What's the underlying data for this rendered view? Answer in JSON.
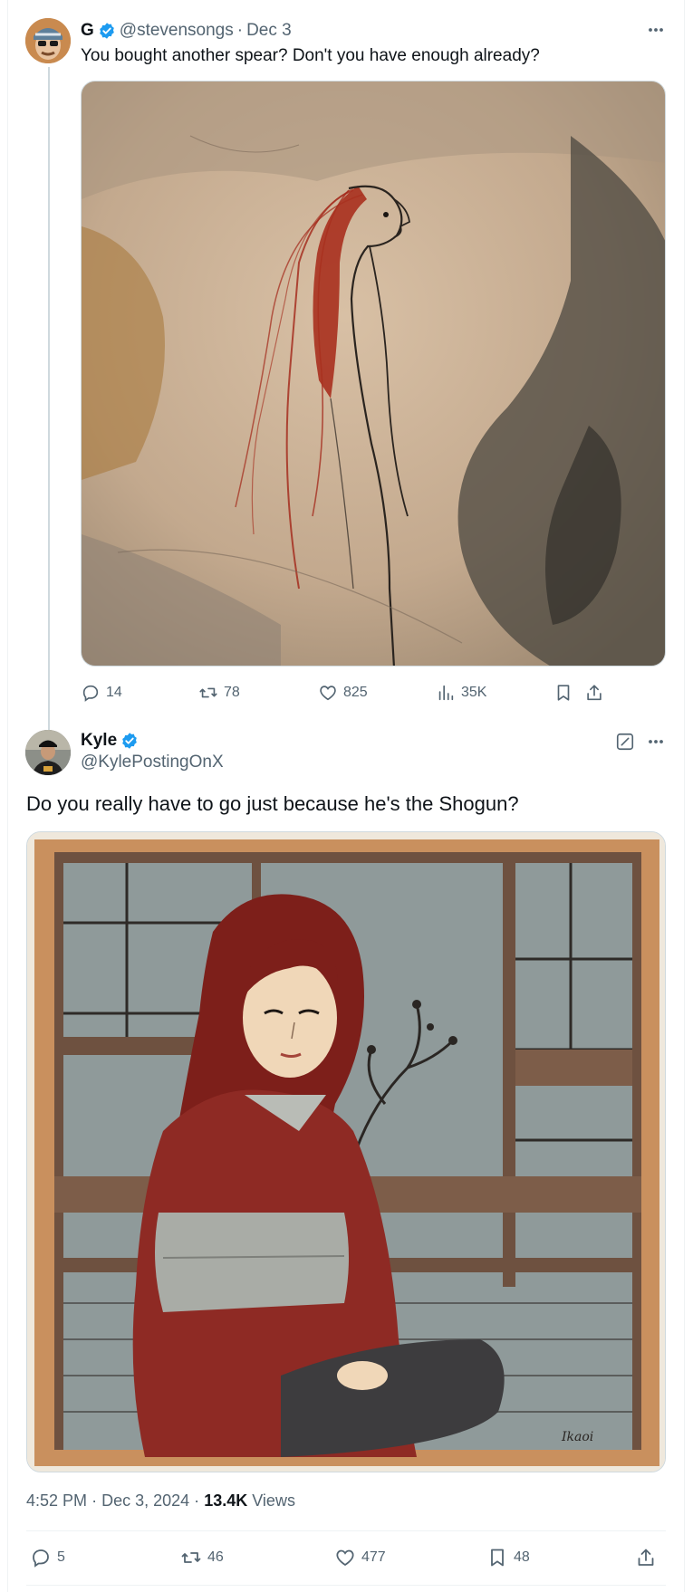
{
  "parent_tweet": {
    "display_name": "G",
    "handle": "@stevensongs",
    "separator": "·",
    "date": "Dec 3",
    "text": "You bought another spear? Don't you have enough already?",
    "replies": "14",
    "reposts": "78",
    "likes": "825",
    "views": "35K"
  },
  "main_tweet": {
    "display_name": "Kyle",
    "handle": "@KylePostingOnX",
    "text": "Do you really have to go just because he's the Shogun?",
    "time": "4:52 PM",
    "date": "Dec 3, 2024",
    "dot1": "·",
    "dot2": "·",
    "views_count": "13.4K",
    "views_label": "Views",
    "replies": "5",
    "reposts": "46",
    "likes": "477",
    "bookmarks": "48",
    "signature_text": "Ikaoi"
  },
  "icons": {
    "verified": "verified-badge-icon",
    "more": "more-icon",
    "grok": "grok-icon",
    "reply": "reply-icon",
    "repost": "repost-icon",
    "like": "heart-icon",
    "views": "analytics-icon",
    "bookmark": "bookmark-icon",
    "share": "share-icon"
  },
  "colors": {
    "text": "#0f1419",
    "muted": "#536471",
    "verified": "#1d9bf0",
    "border": "#cfd9de",
    "hair": "#a8281e"
  }
}
